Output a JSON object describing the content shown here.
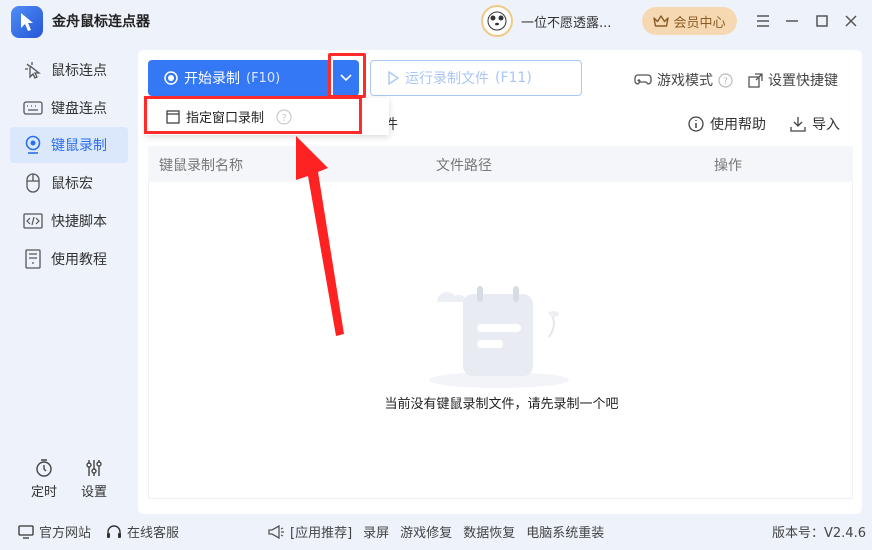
{
  "app": {
    "title": "金舟鼠标连点器",
    "user_name": "一位不愿透露...",
    "vip_label": "会员中心"
  },
  "sidebar": {
    "items": [
      {
        "label": "鼠标连点",
        "icon": "cursor-click-icon"
      },
      {
        "label": "键盘连点",
        "icon": "keyboard-icon"
      },
      {
        "label": "键鼠录制",
        "icon": "record-icon"
      },
      {
        "label": "鼠标宏",
        "icon": "mouse-icon"
      },
      {
        "label": "快捷脚本",
        "icon": "code-icon"
      },
      {
        "label": "使用教程",
        "icon": "book-icon"
      }
    ],
    "active_index": 2,
    "timer_label": "定时",
    "settings_label": "设置"
  },
  "toolbar": {
    "start_label": "开始录制",
    "start_hotkey": "(F10)",
    "run_label": "运行录制文件",
    "run_hotkey": "(F11)",
    "game_mode_label": "游戏模式",
    "shortcut_label": "设置快捷键",
    "help_label": "使用帮助",
    "import_label": "导入",
    "partial_tab_label": "件"
  },
  "dropdown": {
    "item_label": "指定窗口录制"
  },
  "table": {
    "columns": [
      "键鼠录制名称",
      "文件路径",
      "操作"
    ],
    "rows": [],
    "empty_text": "当前没有键鼠录制文件，请先录制一个吧"
  },
  "footer": {
    "website_label": "官方网站",
    "service_label": "在线客服",
    "recommend_label": "[应用推荐]",
    "links": [
      "录屏",
      "游戏修复",
      "数据恢复",
      "电脑系统重装"
    ],
    "version": "版本号：V2.4.6"
  },
  "colors": {
    "accent": "#3478f6",
    "highlight": "#ff2a2a",
    "vip_bg": "#f6d9b3"
  }
}
